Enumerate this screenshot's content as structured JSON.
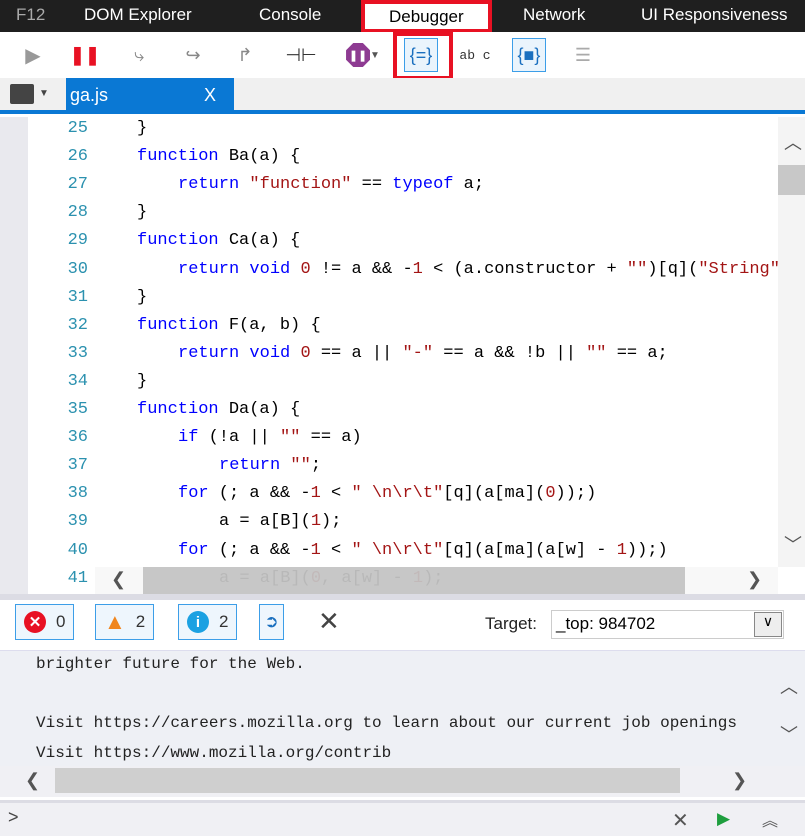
{
  "tabs": {
    "f12": "F12",
    "items": [
      "DOM Explorer",
      "Console",
      "Debugger",
      "Network",
      "UI Responsiveness"
    ],
    "selected": "Debugger"
  },
  "toolbar": {
    "icons": [
      "continue-icon",
      "break-icon",
      "step-into-icon",
      "step-over-icon",
      "step-out-icon",
      "break-on-new-worker-icon",
      "exception-behavior-icon",
      "pretty-print-icon",
      "word-wrap-icon",
      "just-my-code-icon",
      "source-maps-icon"
    ],
    "word_wrap_glyph": "ab c"
  },
  "file": {
    "name": "ga.js",
    "close": "X"
  },
  "code": {
    "lines": [
      {
        "n": "25",
        "i": 0,
        "t": [
          [
            "p",
            "}"
          ]
        ]
      },
      {
        "n": "26",
        "i": 0,
        "t": [
          [
            "k",
            "function"
          ],
          [
            "p",
            " Ba(a) {"
          ]
        ]
      },
      {
        "n": "27",
        "i": 1,
        "t": [
          [
            "k",
            "return"
          ],
          [
            "p",
            " "
          ],
          [
            "s",
            "\"function\""
          ],
          [
            "p",
            " == "
          ],
          [
            "k",
            "typeof"
          ],
          [
            "p",
            " a;"
          ]
        ]
      },
      {
        "n": "28",
        "i": 0,
        "t": [
          [
            "p",
            "}"
          ]
        ]
      },
      {
        "n": "29",
        "i": 0,
        "t": [
          [
            "k",
            "function"
          ],
          [
            "p",
            " Ca(a) {"
          ]
        ]
      },
      {
        "n": "30",
        "i": 1,
        "t": [
          [
            "k",
            "return"
          ],
          [
            "p",
            " "
          ],
          [
            "k",
            "void"
          ],
          [
            "p",
            " "
          ],
          [
            "n",
            "0"
          ],
          [
            "p",
            " != a && -"
          ],
          [
            "n",
            "1"
          ],
          [
            "p",
            " < (a.constructor + "
          ],
          [
            "s",
            "\"\""
          ],
          [
            "p",
            ")[q]("
          ],
          [
            "s",
            "\"String\""
          ],
          [
            "p",
            ")."
          ]
        ]
      },
      {
        "n": "31",
        "i": 0,
        "t": [
          [
            "p",
            "}"
          ]
        ]
      },
      {
        "n": "32",
        "i": 0,
        "t": [
          [
            "k",
            "function"
          ],
          [
            "p",
            " F(a, b) {"
          ]
        ]
      },
      {
        "n": "33",
        "i": 1,
        "t": [
          [
            "k",
            "return"
          ],
          [
            "p",
            " "
          ],
          [
            "k",
            "void"
          ],
          [
            "p",
            " "
          ],
          [
            "n",
            "0"
          ],
          [
            "p",
            " == a || "
          ],
          [
            "s",
            "\"-\""
          ],
          [
            "p",
            " == a && !b || "
          ],
          [
            "s",
            "\"\""
          ],
          [
            "p",
            " == a;"
          ]
        ]
      },
      {
        "n": "34",
        "i": 0,
        "t": [
          [
            "p",
            "}"
          ]
        ]
      },
      {
        "n": "35",
        "i": 0,
        "t": [
          [
            "k",
            "function"
          ],
          [
            "p",
            " Da(a) {"
          ]
        ]
      },
      {
        "n": "36",
        "i": 1,
        "t": [
          [
            "k",
            "if"
          ],
          [
            "p",
            " (!a || "
          ],
          [
            "s",
            "\"\""
          ],
          [
            "p",
            " == a)"
          ]
        ]
      },
      {
        "n": "37",
        "i": 2,
        "t": [
          [
            "k",
            "return"
          ],
          [
            "p",
            " "
          ],
          [
            "s",
            "\"\""
          ],
          [
            "p",
            ";"
          ]
        ]
      },
      {
        "n": "38",
        "i": 1,
        "t": [
          [
            "k",
            "for"
          ],
          [
            "p",
            " (; a && -"
          ],
          [
            "n",
            "1"
          ],
          [
            "p",
            " < "
          ],
          [
            "s",
            "\" \\n\\r\\t\""
          ],
          [
            "p",
            "[q](a[ma]("
          ],
          [
            "n",
            "0"
          ],
          [
            "p",
            "));)"
          ]
        ]
      },
      {
        "n": "39",
        "i": 2,
        "t": [
          [
            "p",
            "a = a[B]("
          ],
          [
            "n",
            "1"
          ],
          [
            "p",
            ");"
          ]
        ]
      },
      {
        "n": "40",
        "i": 1,
        "t": [
          [
            "k",
            "for"
          ],
          [
            "p",
            " (; a && -"
          ],
          [
            "n",
            "1"
          ],
          [
            "p",
            " < "
          ],
          [
            "s",
            "\" \\n\\r\\t\""
          ],
          [
            "p",
            "[q](a[ma](a[w] - "
          ],
          [
            "n",
            "1"
          ],
          [
            "p",
            "));)"
          ]
        ]
      },
      {
        "n": "41",
        "i": 2,
        "t": [
          [
            "p",
            "a = a[B]("
          ],
          [
            "n",
            "0"
          ],
          [
            "p",
            ", a[w] - "
          ],
          [
            "n",
            "1"
          ],
          [
            "p",
            ");"
          ]
        ]
      }
    ]
  },
  "console": {
    "errors": "0",
    "warnings": "2",
    "info": "2",
    "target_label": "Target:",
    "target_value": "_top: 984702",
    "output": [
      "brighter future for the Web.",
      "",
      "Visit https://careers.mozilla.org to learn about our current job openings",
      "Visit https://www.mozilla.org/contrib"
    ],
    "prompt": ">"
  },
  "colors": {
    "accent": "#0a78d4",
    "highlight": "#e81123",
    "keyword": "#0000ff",
    "string": "#a31515",
    "line_number": "#2b91af"
  }
}
